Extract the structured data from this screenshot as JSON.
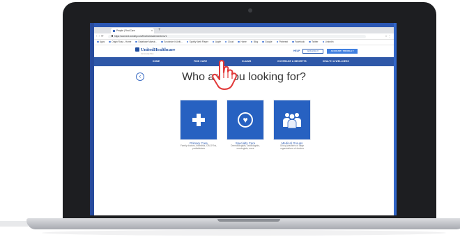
{
  "browser": {
    "tab_title": "People | Find Care",
    "new_tab": "+",
    "url": "https://connect.werally.com/find/medical/members/1",
    "bookmarks": [
      "Apps",
      "Origin Rosa - Home",
      "Database Maestr...",
      "Scrutinize It Uniti...",
      "Spotify Web Player",
      "Apple",
      "Cloud",
      "Home",
      "Blog",
      "Google",
      "Pinterest",
      "Facebook",
      "Twitter",
      "LinkedIn"
    ]
  },
  "site": {
    "logo": "UnitedHealthcare",
    "logo_sub": "Community Plan",
    "help_label": "HELP",
    "language_label": "ENGLISH ▾",
    "account_label": "ACCOUNT / PROFILE ▾"
  },
  "nav": {
    "items": [
      "HOME",
      "FIND CARE",
      "CLAIMS",
      "COVERAGE & BENEFITS",
      "HEALTH & WELLNESS"
    ]
  },
  "main": {
    "headline": "Who are you looking for?",
    "cards": [
      {
        "title": "Primary Care",
        "desc": "Family doctors, internists, OB-GYNs, pediatricians",
        "icon": "medical-cross-icon"
      },
      {
        "title": "Specialty Care",
        "desc": "Dermatologists, cardiologists, oncologists, more",
        "icon": "heart-icon"
      },
      {
        "title": "Medical Groups",
        "desc": "Group practices or large organizations of doctors",
        "icon": "group-icon"
      }
    ]
  },
  "colors": {
    "brand_blue": "#2f58a8",
    "card_blue": "#2761c1",
    "desktop_blue": "#2b57b3"
  }
}
